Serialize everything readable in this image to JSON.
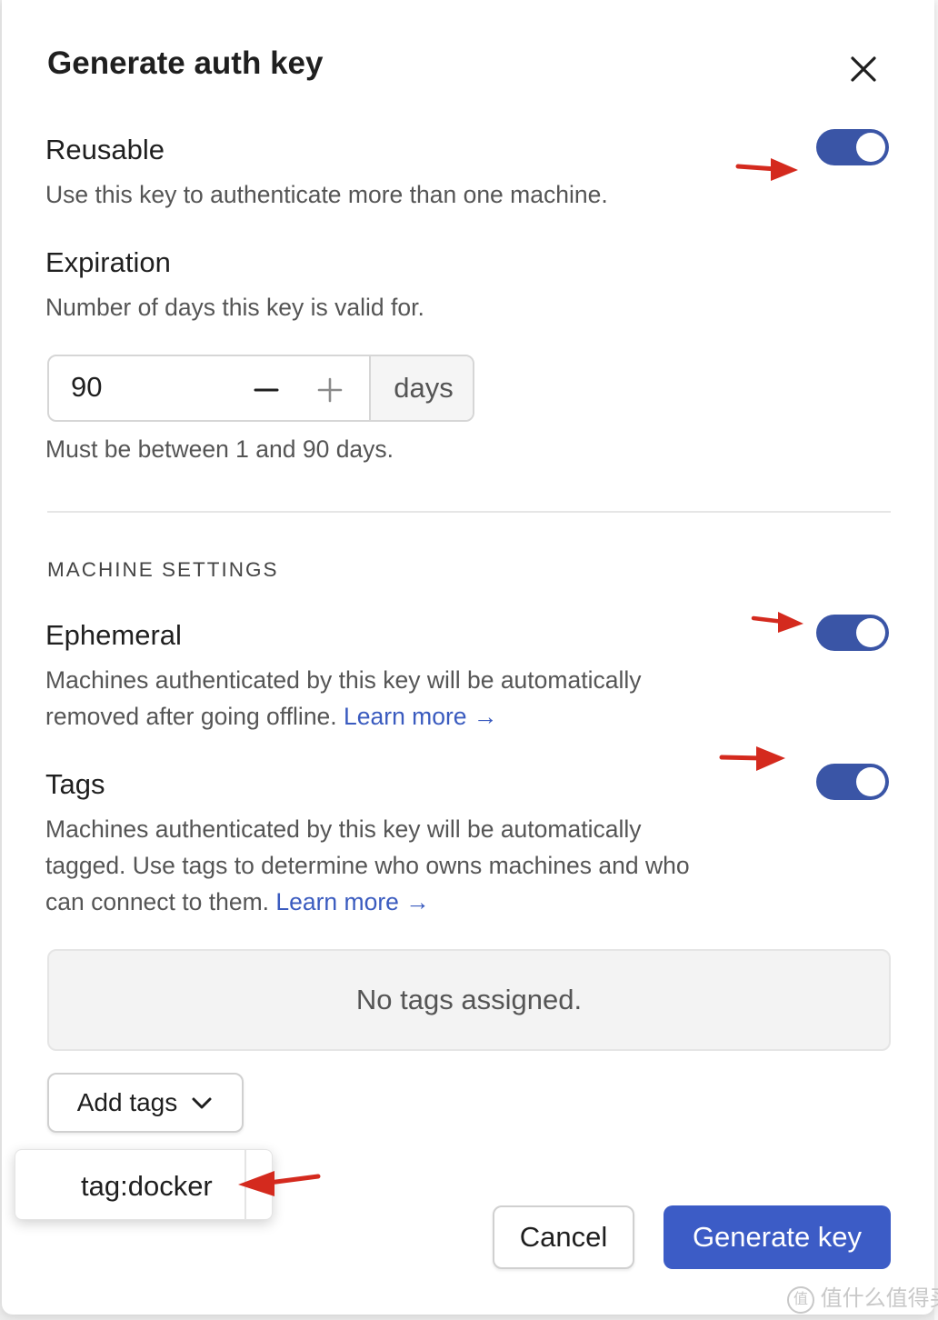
{
  "dialog": {
    "title": "Generate auth key"
  },
  "reusable": {
    "label": "Reusable",
    "description": "Use this key to authenticate more than one machine.",
    "enabled": true
  },
  "expiration": {
    "label": "Expiration",
    "description": "Number of days this key is valid for.",
    "value": "90",
    "minus_icon": "minus-icon",
    "plus_icon": "plus-icon",
    "unit": "days",
    "hint": "Must be between 1 and 90 days."
  },
  "machine_settings": {
    "heading": "MACHINE SETTINGS",
    "ephemeral": {
      "label": "Ephemeral",
      "description_1": "Machines authenticated by this key will be automatically",
      "description_2": "removed after going offline.",
      "link": "Learn more →",
      "enabled": true
    },
    "tags": {
      "label": "Tags",
      "description_1": "Machines authenticated by this key will be automatically",
      "description_2": "tagged. Use tags to determine who owns machines and who",
      "description_3": "can connect to them.",
      "link": "Learn more →",
      "enabled": true,
      "empty_text": "No tags assigned.",
      "add_button": "Add tags",
      "options": [
        "tag:docker"
      ]
    }
  },
  "footer": {
    "cancel": "Cancel",
    "generate": "Generate key"
  },
  "watermark": "值什么值得买",
  "colors": {
    "accent": "#3c5cc6",
    "toggle_on": "#3a55a6",
    "link": "#3a5bbf",
    "annotation_arrow": "#d42a1e"
  }
}
